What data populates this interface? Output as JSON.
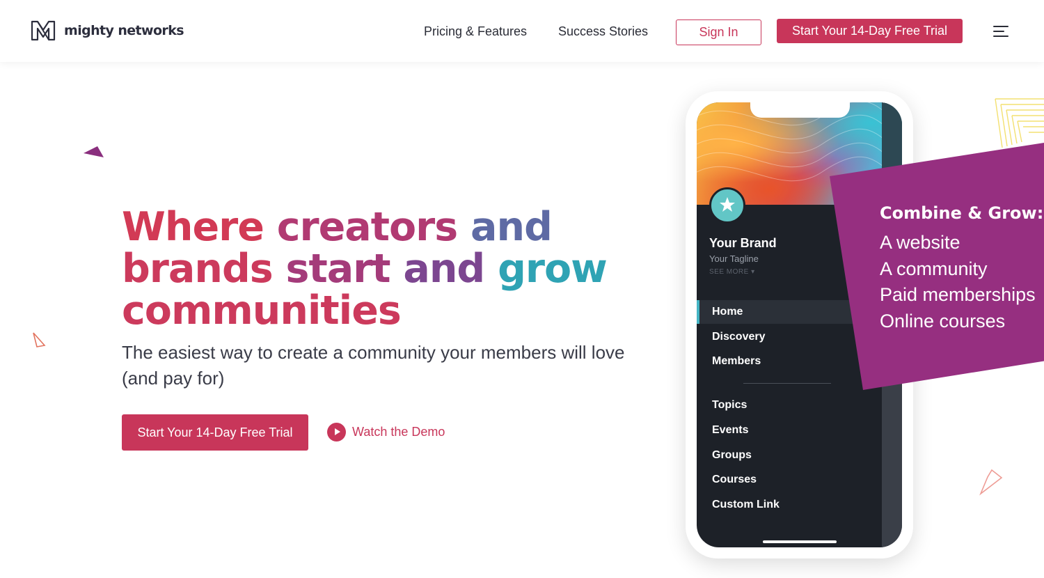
{
  "header": {
    "logo_text": "mighty networks",
    "nav": {
      "pricing": "Pricing & Features",
      "stories": "Success Stories"
    },
    "sign_in": "Sign In",
    "trial_button": "Start Your 14-Day Free Trial",
    "menu_icon": "hamburger-menu-icon"
  },
  "hero": {
    "title_line1": [
      "Where ",
      "creators ",
      "and"
    ],
    "title_line2": [
      "brands ",
      "start ",
      "and ",
      "grow"
    ],
    "title_line3": "communities",
    "subtitle": "The easiest way to create a community your members will love (and pay for)",
    "trial_button": "Start Your 14-Day Free Trial",
    "demo_link": "Watch the Demo"
  },
  "phone": {
    "brand_name": "Your Brand",
    "tagline": "Your Tagline",
    "see_more": "SEE MORE",
    "menu_primary": [
      "Home",
      "Discovery",
      "Members"
    ],
    "menu_secondary": [
      "Topics",
      "Events",
      "Groups",
      "Courses",
      "Custom Link"
    ],
    "active_item": "Home"
  },
  "callout": {
    "title": "Combine & Grow:",
    "items": [
      "A website",
      "A community",
      "Paid memberships",
      "Online courses"
    ]
  },
  "colors": {
    "brand_red": "#c8365a",
    "purple": "#962f80",
    "teal": "#2aa4b8",
    "title_gradient": [
      "#d23a55",
      "#b13a72",
      "#8a3f8c",
      "#5e5a9c",
      "#2fa3b4"
    ]
  }
}
